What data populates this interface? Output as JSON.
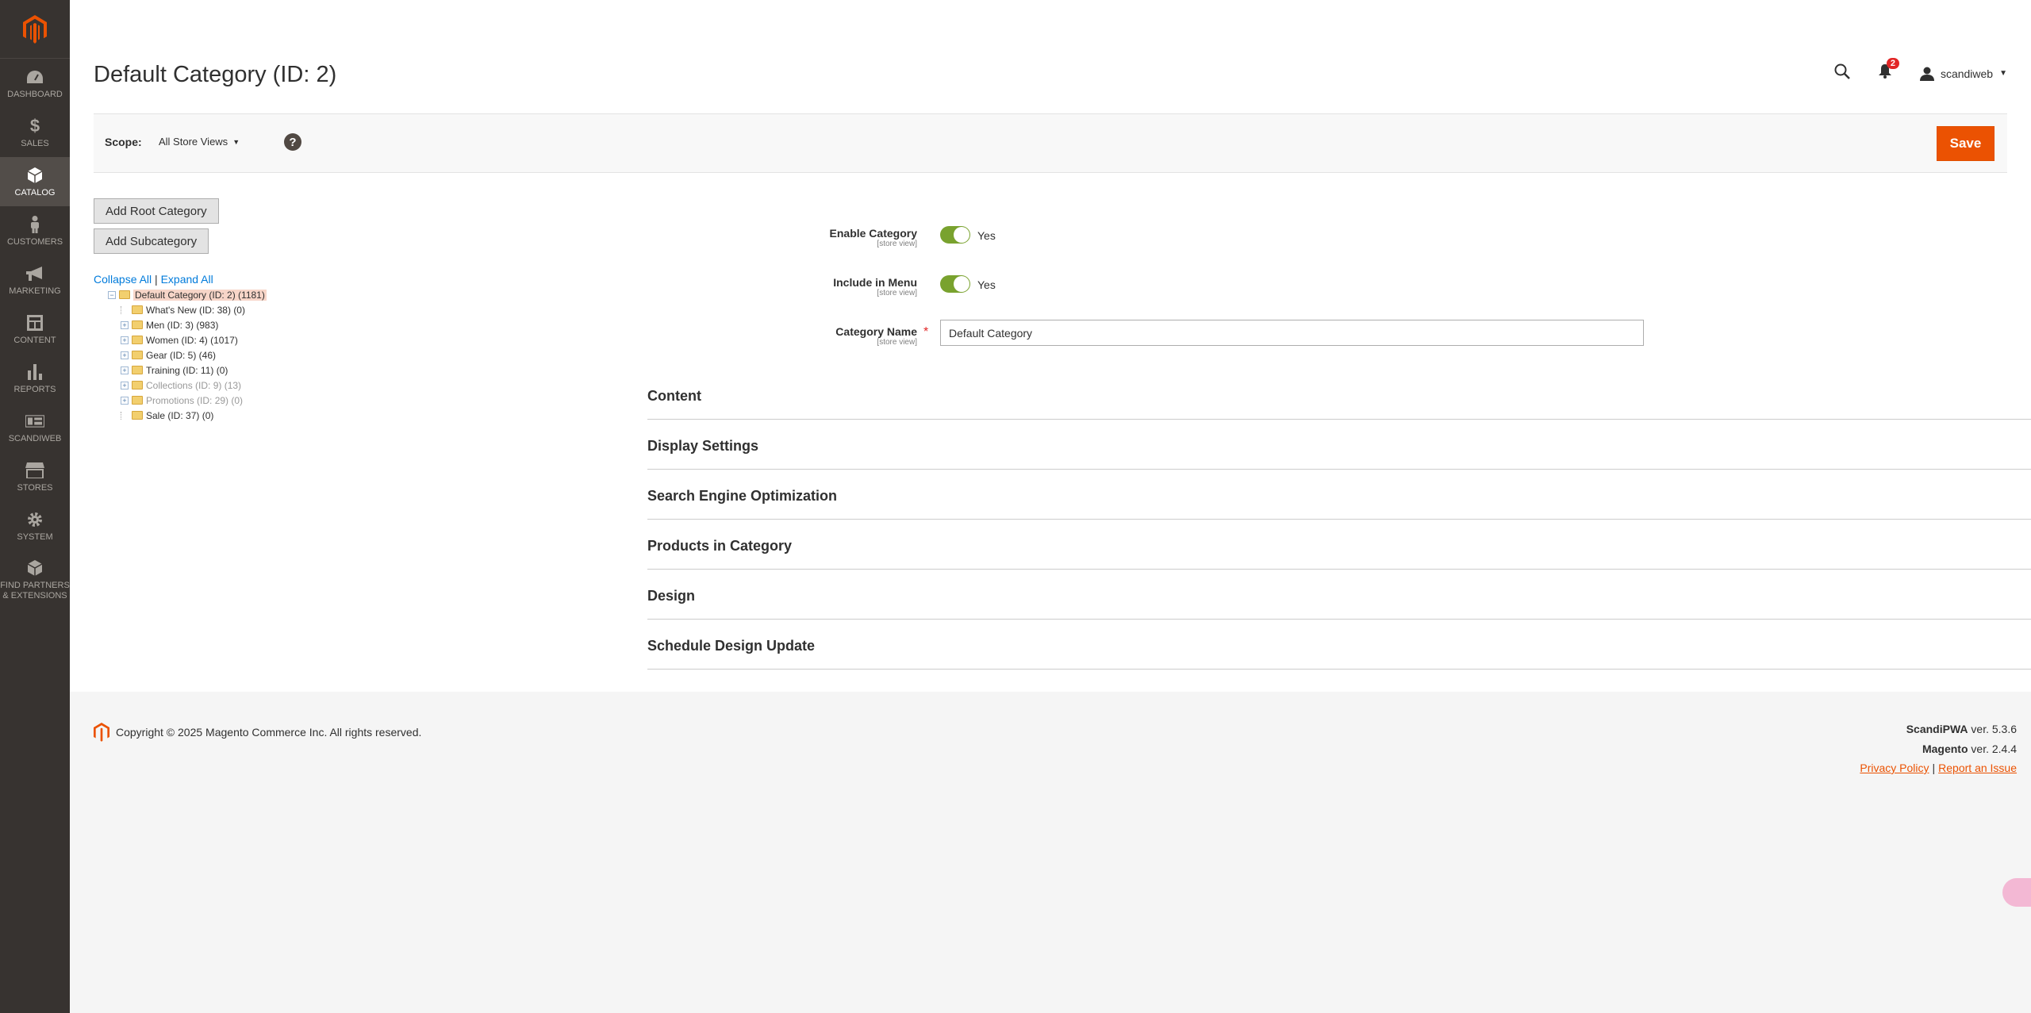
{
  "sidebar": {
    "items": [
      {
        "label": "DASHBOARD",
        "icon": "dashboard-icon"
      },
      {
        "label": "SALES",
        "icon": "dollar-icon"
      },
      {
        "label": "CATALOG",
        "icon": "cube-icon"
      },
      {
        "label": "CUSTOMERS",
        "icon": "person-icon"
      },
      {
        "label": "MARKETING",
        "icon": "megaphone-icon"
      },
      {
        "label": "CONTENT",
        "icon": "layout-icon"
      },
      {
        "label": "REPORTS",
        "icon": "bar-chart-icon"
      },
      {
        "label": "SCANDIWEB",
        "icon": "storefront-icon"
      },
      {
        "label": "STORES",
        "icon": "store-icon"
      },
      {
        "label": "SYSTEM",
        "icon": "gear-icon"
      },
      {
        "label": "FIND PARTNERS & EXTENSIONS",
        "icon": "box-icon"
      }
    ],
    "active": "CATALOG"
  },
  "header": {
    "title": "Default Category (ID: 2)",
    "notifications_count": "2",
    "username": "scandiweb"
  },
  "scope": {
    "label": "Scope:",
    "value": "All Store Views",
    "help": "?",
    "save_label": "Save"
  },
  "tree": {
    "add_root_label": "Add Root Category",
    "add_sub_label": "Add Subcategory",
    "collapse_all": "Collapse All",
    "separator": "|",
    "expand_all": "Expand All",
    "nodes": [
      {
        "label": "Default Category (ID: 2) (1181)",
        "level": 0,
        "toggle": "−",
        "selected": true
      },
      {
        "label": "What's New (ID: 38) (0)",
        "level": 1,
        "toggle": ""
      },
      {
        "label": "Men (ID: 3) (983)",
        "level": 1,
        "toggle": "+"
      },
      {
        "label": "Women (ID: 4) (1017)",
        "level": 1,
        "toggle": "+"
      },
      {
        "label": "Gear (ID: 5) (46)",
        "level": 1,
        "toggle": "+"
      },
      {
        "label": "Training (ID: 11) (0)",
        "level": 1,
        "toggle": "+"
      },
      {
        "label": "Collections (ID: 9) (13)",
        "level": 1,
        "toggle": "+",
        "inactive": true
      },
      {
        "label": "Promotions (ID: 29) (0)",
        "level": 1,
        "toggle": "+",
        "inactive": true
      },
      {
        "label": "Sale (ID: 37) (0)",
        "level": 1,
        "toggle": ""
      }
    ]
  },
  "form": {
    "enable_label": "Enable Category",
    "enable_scope": "[store view]",
    "enable_value": "Yes",
    "menu_label": "Include in Menu",
    "menu_scope": "[store view]",
    "menu_value": "Yes",
    "name_label": "Category Name",
    "name_scope": "[store view]",
    "name_required": "*",
    "name_value": "Default Category"
  },
  "sections": [
    "Content",
    "Display Settings",
    "Search Engine Optimization",
    "Products in Category",
    "Design",
    "Schedule Design Update"
  ],
  "footer": {
    "copyright": "Copyright © 2025 Magento Commerce Inc. All rights reserved.",
    "scandipwa_name": "ScandiPWA",
    "scandipwa_ver": " ver. 5.3.6",
    "magento_name": "Magento",
    "magento_ver": " ver. 2.4.4",
    "privacy": "Privacy Policy",
    "sep": "|",
    "report": "Report an Issue"
  },
  "colors": {
    "accent": "#eb5202",
    "sidebar": "#373330",
    "toggle_on": "#79a22e",
    "link": "#007bdb"
  }
}
